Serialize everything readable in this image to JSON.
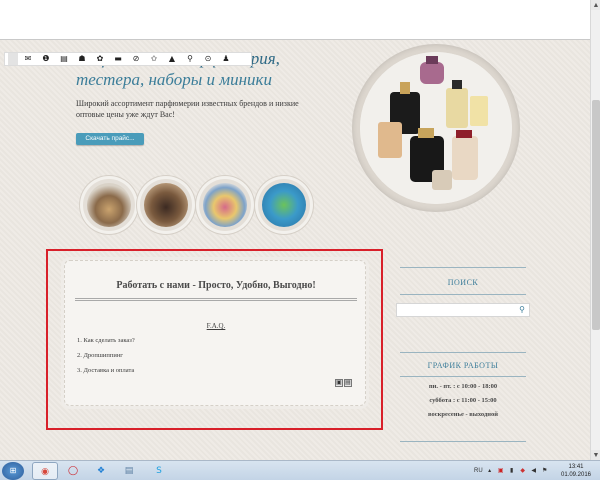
{
  "toolbar": {
    "icons": [
      "blank-icon",
      "mail-icon",
      "info-icon",
      "document-icon",
      "bucket-icon",
      "gear-icon",
      "folder-icon",
      "ban-icon",
      "star-icon",
      "bell-icon",
      "search-icon",
      "eye-icon",
      "person-icon"
    ],
    "glyphs": [
      "",
      "✉",
      "❶",
      "▤",
      "☗",
      "✿",
      "▬",
      "⊘",
      "✩",
      "▲",
      "⚲",
      "⊙",
      "♟"
    ]
  },
  "hero": {
    "title_line1": "Национальная парфюмерия,",
    "title_line2": "тестера, наборы и миники",
    "description": "Широкий ассортимент парфюмерии известных брендов и низкие оптовые цены уже ждут Вас!",
    "button_label": "Скачать прайс..."
  },
  "card": {
    "title": "Работать с нами - Просто, Удобно, Выгодно!",
    "faq_label": "F.A.Q.",
    "items": [
      "1. Как сделать заказ?",
      "2. Дропшиппинг",
      "3. Доставка и оплата"
    ]
  },
  "sidebar": {
    "search_heading": "ПОИСК",
    "schedule_heading": "ГРАФИК РАБОТЫ",
    "schedule": [
      "пн. - пт. : с 10:00 - 18:00",
      "суббота : с 11:00 - 15:00",
      "воскресенье - выходной"
    ]
  },
  "taskbar": {
    "lang": "RU",
    "time": "13:41",
    "date": "01.09.2016"
  },
  "colors": {
    "accent": "#3c7d9a",
    "button": "#4a9cba",
    "highlight_border": "#d8202a",
    "page_bg": "#ede9e3"
  }
}
